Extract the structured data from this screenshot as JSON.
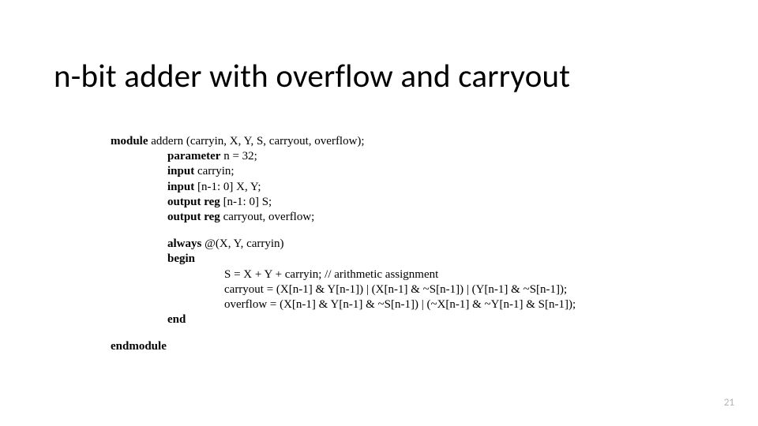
{
  "title": "n-bit adder with overflow and carryout",
  "code": {
    "l1": {
      "kw": "module",
      "rest": " addern (carryin, X, Y, S, carryout, overflow);"
    },
    "l2": {
      "kw": "parameter",
      "rest": " n = 32;"
    },
    "l3": {
      "kw": "input",
      "rest": " carryin;"
    },
    "l4": {
      "kw": "input",
      "rest": " [n-1: 0] X, Y;"
    },
    "l5": {
      "kw": "output reg",
      "rest": " [n-1: 0] S;"
    },
    "l6": {
      "kw": "output reg",
      "rest": " carryout, overflow;"
    },
    "l7": {
      "kw": "always",
      "rest": " @(X, Y, carryin)"
    },
    "l8": {
      "kw": "begin",
      "rest": ""
    },
    "l9": {
      "kw": "",
      "rest": "S = X + Y + carryin;   // arithmetic assignment"
    },
    "l10": {
      "kw": "",
      "rest": "carryout = (X[n-1] & Y[n-1]) | (X[n-1] & ~S[n-1]) | (Y[n-1] & ~S[n-1]);"
    },
    "l11": {
      "kw": "",
      "rest": "overflow = (X[n-1] & Y[n-1] & ~S[n-1]) | (~X[n-1] & ~Y[n-1] & S[n-1]);"
    },
    "l12": {
      "kw": "end",
      "rest": ""
    },
    "l13": {
      "kw": "endmodule",
      "rest": ""
    }
  },
  "page_number": "21"
}
